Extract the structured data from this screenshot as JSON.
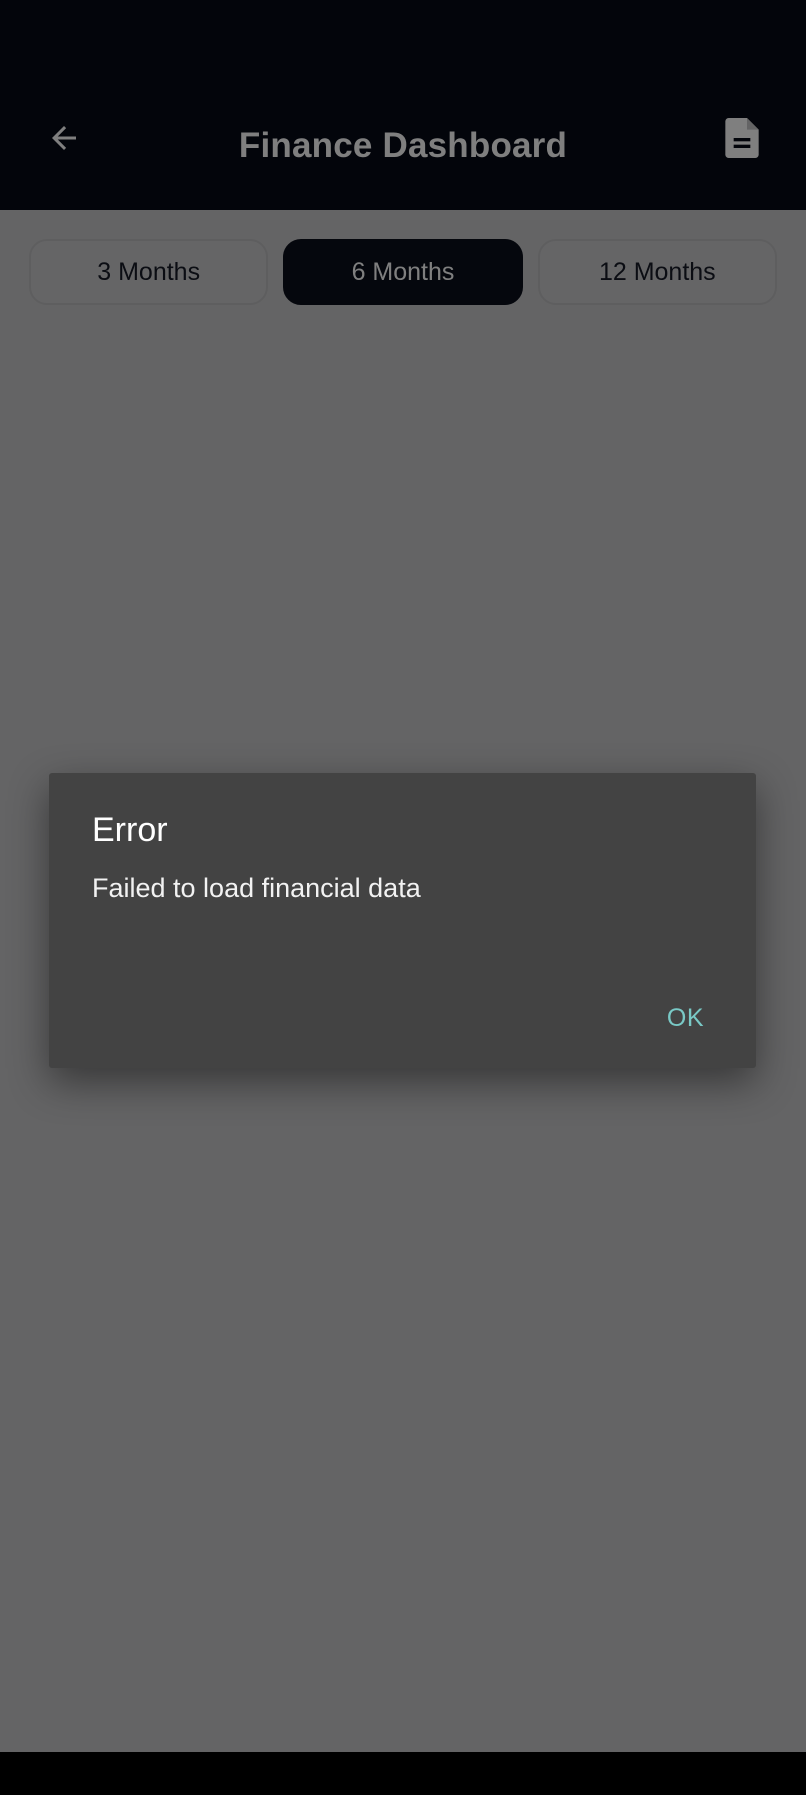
{
  "app": {
    "title": "Finance Dashboard",
    "back_icon": "arrow-left-icon",
    "report_icon": "document-icon"
  },
  "period_selector": {
    "options": [
      "3 Months",
      "6 Months",
      "12 Months"
    ],
    "selected": "6 Months"
  },
  "dialog": {
    "title": "Error",
    "message": "Failed to load financial data",
    "ok_label": "OK"
  },
  "colors": {
    "appbar": "#060a16",
    "selected_segment": "#0b0f1b",
    "dialog_bg": "#434343",
    "dialog_action": "#79c9c6"
  }
}
